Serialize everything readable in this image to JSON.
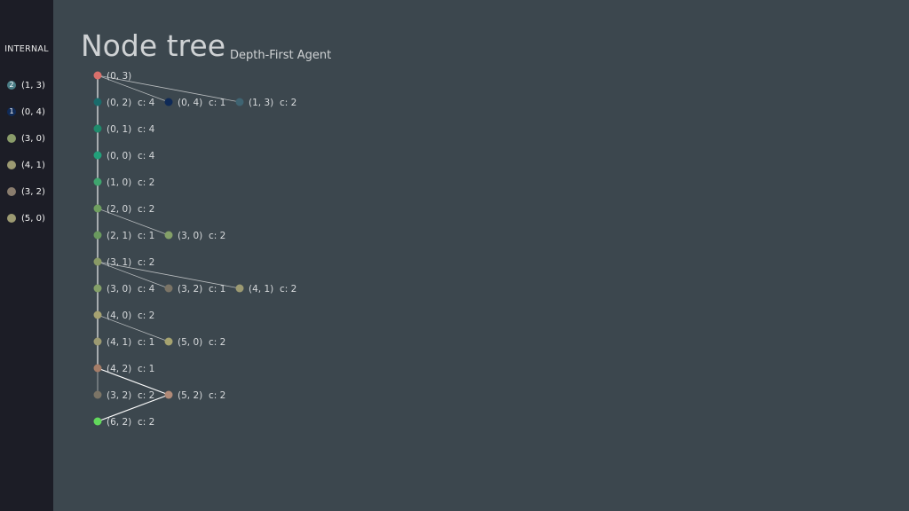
{
  "sidebar": {
    "title": "INTERNAL",
    "items": [
      {
        "count": "2",
        "label": "(1, 3)",
        "color": "#4a7d86"
      },
      {
        "count": "1",
        "label": "(0, 4)",
        "color": "#0f2a57"
      },
      {
        "count": "",
        "label": "(3, 0)",
        "color": "#8a9c6a"
      },
      {
        "count": "",
        "label": "(4, 1)",
        "color": "#9c9a72"
      },
      {
        "count": "",
        "label": "(3, 2)",
        "color": "#8a7d6e"
      },
      {
        "count": "",
        "label": "(5, 0)",
        "color": "#9c9a72"
      }
    ]
  },
  "header": {
    "title": "Node tree",
    "subtitle": "Depth-First Agent"
  },
  "tree": {
    "nodes": [
      {
        "id": 0,
        "label": "(0, 3)",
        "cost": "",
        "color": "#d9706b",
        "row": 0,
        "col": 0
      },
      {
        "id": 1,
        "label": "(0, 2)",
        "cost": "c: 4",
        "color": "#1a6b6b",
        "row": 1,
        "col": 0
      },
      {
        "id": 2,
        "label": "(0, 4)",
        "cost": "c: 1",
        "color": "#0f2a57",
        "row": 1,
        "col": 1
      },
      {
        "id": 3,
        "label": "(1, 3)",
        "cost": "c: 2",
        "color": "#3f6472",
        "row": 1,
        "col": 2
      },
      {
        "id": 4,
        "label": "(0, 1)",
        "cost": "c: 4",
        "color": "#1f8a6b",
        "row": 2,
        "col": 0
      },
      {
        "id": 5,
        "label": "(0, 0)",
        "cost": "c: 4",
        "color": "#22a07a",
        "row": 3,
        "col": 0
      },
      {
        "id": 6,
        "label": "(1, 0)",
        "cost": "c: 2",
        "color": "#3fa56e",
        "row": 4,
        "col": 0
      },
      {
        "id": 7,
        "label": "(2, 0)",
        "cost": "c: 2",
        "color": "#6f9f5f",
        "row": 5,
        "col": 0
      },
      {
        "id": 8,
        "label": "(2, 1)",
        "cost": "c: 1",
        "color": "#6a9a5e",
        "row": 6,
        "col": 0
      },
      {
        "id": 9,
        "label": "(3, 0)",
        "cost": "c: 2",
        "color": "#84a068",
        "row": 6,
        "col": 1
      },
      {
        "id": 10,
        "label": "(3, 1)",
        "cost": "c: 2",
        "color": "#8a9a66",
        "row": 7,
        "col": 0
      },
      {
        "id": 11,
        "label": "(3, 0)",
        "cost": "c: 4",
        "color": "#84a068",
        "row": 8,
        "col": 0
      },
      {
        "id": 12,
        "label": "(3, 2)",
        "cost": "c: 1",
        "color": "#7b7466",
        "row": 8,
        "col": 1
      },
      {
        "id": 13,
        "label": "(4, 1)",
        "cost": "c: 2",
        "color": "#9c9a72",
        "row": 8,
        "col": 2
      },
      {
        "id": 14,
        "label": "(4, 0)",
        "cost": "c: 2",
        "color": "#a6a271",
        "row": 9,
        "col": 0
      },
      {
        "id": 15,
        "label": "(4, 1)",
        "cost": "c: 1",
        "color": "#9c9a72",
        "row": 10,
        "col": 0
      },
      {
        "id": 16,
        "label": "(5, 0)",
        "cost": "c: 2",
        "color": "#a6a36f",
        "row": 10,
        "col": 1
      },
      {
        "id": 17,
        "label": "(4, 2)",
        "cost": "c: 1",
        "color": "#a57d68",
        "row": 11,
        "col": 0
      },
      {
        "id": 18,
        "label": "(3, 2)",
        "cost": "c: 2",
        "color": "#7b7466",
        "row": 12,
        "col": 0
      },
      {
        "id": 19,
        "label": "(5, 2)",
        "cost": "c: 2",
        "color": "#b08a78",
        "row": 12,
        "col": 1
      },
      {
        "id": 20,
        "label": "(6, 2)",
        "cost": "c: 2",
        "color": "#62d85c",
        "row": 13,
        "col": 0
      }
    ],
    "edges": [
      {
        "from": 0,
        "to": 1,
        "highlight": true
      },
      {
        "from": 0,
        "to": 2,
        "highlight": false
      },
      {
        "from": 0,
        "to": 3,
        "highlight": false
      },
      {
        "from": 1,
        "to": 4,
        "highlight": true
      },
      {
        "from": 4,
        "to": 5,
        "highlight": true
      },
      {
        "from": 5,
        "to": 6,
        "highlight": true
      },
      {
        "from": 6,
        "to": 7,
        "highlight": true
      },
      {
        "from": 7,
        "to": 8,
        "highlight": true
      },
      {
        "from": 7,
        "to": 9,
        "highlight": false
      },
      {
        "from": 8,
        "to": 10,
        "highlight": true
      },
      {
        "from": 10,
        "to": 11,
        "highlight": true
      },
      {
        "from": 10,
        "to": 12,
        "highlight": false
      },
      {
        "from": 10,
        "to": 13,
        "highlight": false
      },
      {
        "from": 11,
        "to": 14,
        "highlight": true
      },
      {
        "from": 14,
        "to": 15,
        "highlight": true
      },
      {
        "from": 14,
        "to": 16,
        "highlight": false
      },
      {
        "from": 15,
        "to": 17,
        "highlight": true
      },
      {
        "from": 17,
        "to": 18,
        "highlight": false
      },
      {
        "from": 17,
        "to": 19,
        "highlight": true
      },
      {
        "from": 19,
        "to": 20,
        "highlight": true
      }
    ],
    "edge_color": "#b9bdbf",
    "path_color": "#ffffff"
  }
}
